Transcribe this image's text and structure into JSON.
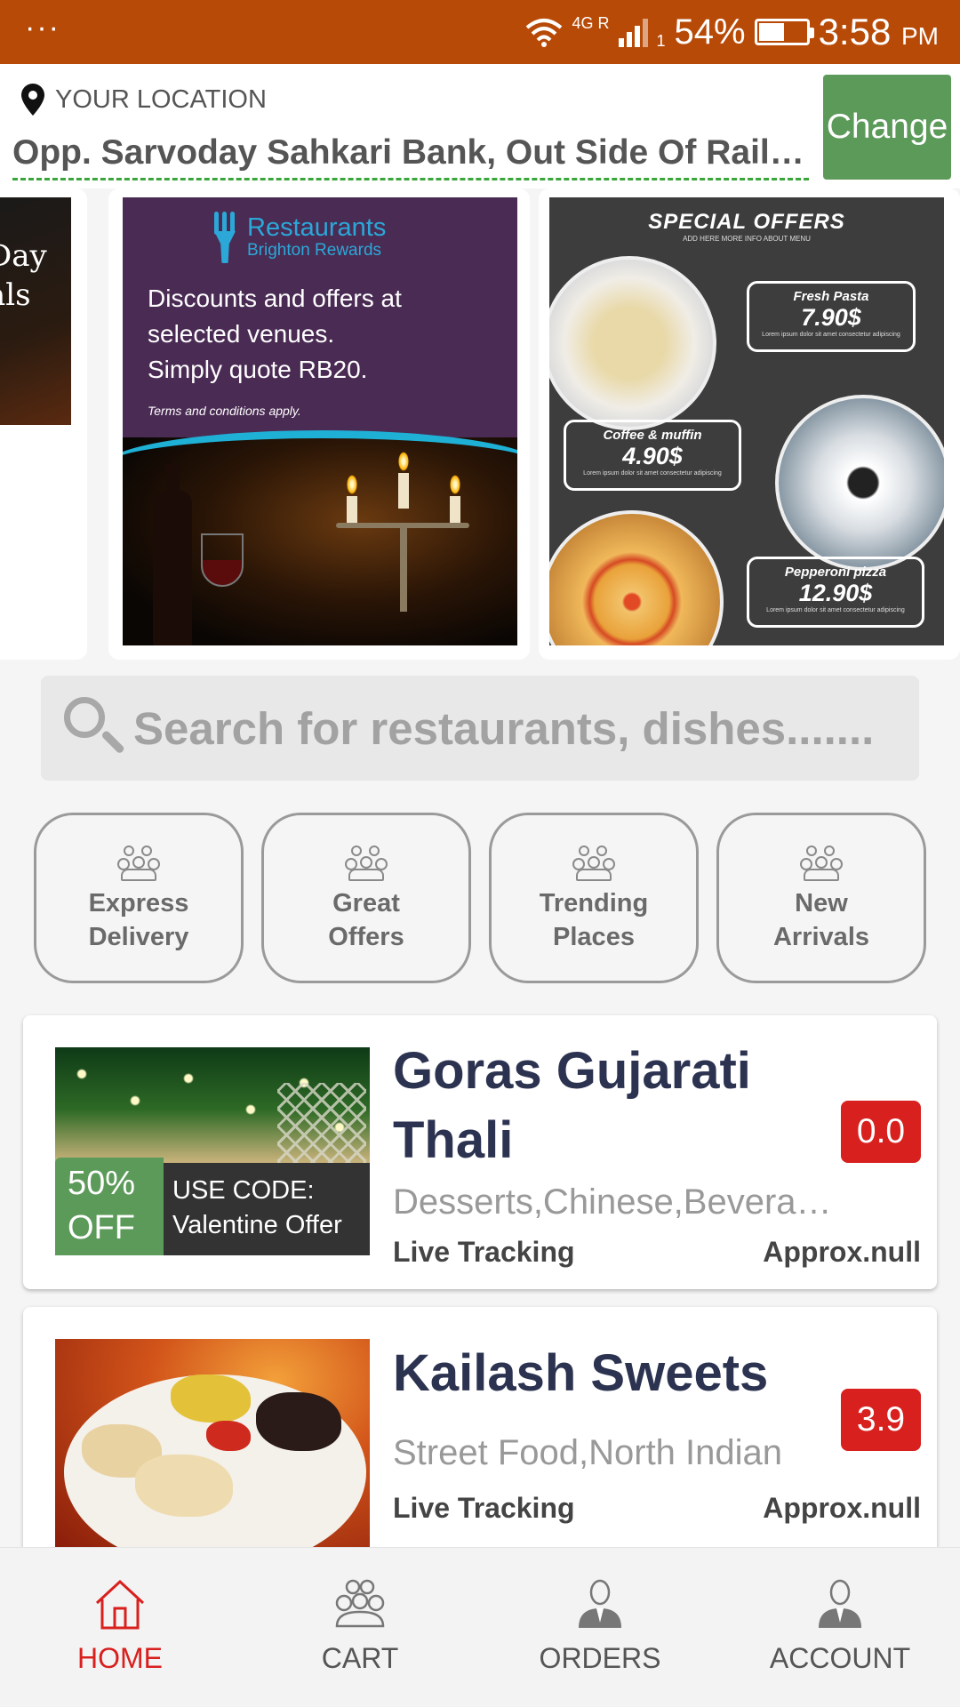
{
  "status_bar": {
    "menu_dots": "···",
    "network": "4G R",
    "network_sub": "1",
    "battery_percent": "54%",
    "battery_level": 0.54,
    "time": "3:58",
    "ampm": "PM"
  },
  "location": {
    "label": "YOUR LOCATION",
    "address": "Opp. Sarvoday Sahkari Bank, Out Side Of Railway Station",
    "change_label": "Change"
  },
  "banners": {
    "banner1": {
      "line1": "Day",
      "line2": "als"
    },
    "banner2": {
      "brand": "Restaurants",
      "brand_sub": "Brighton Rewards",
      "line1": "Discounts and offers at",
      "line2": "selected venues.",
      "line3": "Simply quote RB20.",
      "terms": "Terms and conditions apply."
    },
    "banner3": {
      "title": "SPECIAL OFFERS",
      "subtitle": "ADD HERE MORE INFO ABOUT MENU",
      "items": [
        {
          "name": "Fresh Pasta",
          "price": "7.90$",
          "lorem": "Lorem ipsum dolor sit amet consectetur adipiscing"
        },
        {
          "name": "Coffee & muffin",
          "price": "4.90$",
          "lorem": "Lorem ipsum dolor sit amet consectetur adipiscing"
        },
        {
          "name": "Pepperoni pizza",
          "price": "12.90$",
          "lorem": "Lorem ipsum dolor sit amet consectetur adipiscing"
        }
      ]
    }
  },
  "search": {
    "placeholder": "Search for restaurants, dishes......."
  },
  "categories": [
    {
      "line1": "Express",
      "line2": "Delivery"
    },
    {
      "line1": "Great",
      "line2": "Offers"
    },
    {
      "line1": "Trending",
      "line2": "Places"
    },
    {
      "line1": "New",
      "line2": "Arrivals"
    }
  ],
  "restaurants": [
    {
      "name_line1": "Goras Gujarati",
      "name_line2": "Thali",
      "cuisine": "Desserts,Chinese,Beverages",
      "rating": "0.0",
      "offer_line1": "50%",
      "offer_line2": "OFF",
      "code_line1": "USE CODE:",
      "code_line2": "Valentine Offer",
      "tracking": "Live Tracking",
      "approx": "Approx.null"
    },
    {
      "name_line1": "Kailash Sweets",
      "cuisine": "Street Food,North Indian",
      "rating": "3.9",
      "tracking": "Live Tracking",
      "approx": "Approx.null"
    }
  ],
  "bottom_nav": [
    {
      "label": "HOME",
      "icon": "home-icon",
      "active": true
    },
    {
      "label": "CART",
      "icon": "people-icon",
      "active": false
    },
    {
      "label": "ORDERS",
      "icon": "person-tie-icon",
      "active": false
    },
    {
      "label": "ACCOUNT",
      "icon": "person-tie-icon",
      "active": false
    }
  ],
  "colors": {
    "status_bar": "#b84a07",
    "accent_green": "#5c9a5a",
    "rating_red": "#d8201e",
    "title_navy": "#2c3350"
  }
}
